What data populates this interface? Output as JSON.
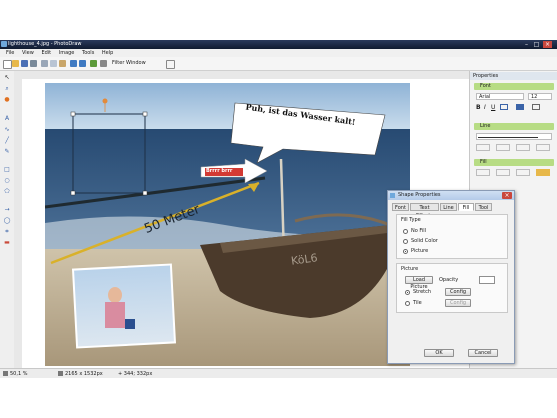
{
  "app": {
    "title": "lighthouse_4.jpg - PhotoDraw"
  },
  "menu": [
    "File",
    "View",
    "Edit",
    "Image",
    "Tools",
    "Help"
  ],
  "toolbar": {
    "filter_window": "Filter Window"
  },
  "canvas": {
    "speech_bubble": "Puh, ist das Wasser kalt!",
    "arrow_label": "Brrrr brrr",
    "measure_label": "50 Meter",
    "boat_label": "KöL6"
  },
  "properties_panel": {
    "title": "Properties",
    "font_group": "Font",
    "font_name": "Arial",
    "font_size": "12",
    "line_group": "Line",
    "fill_group": "Fill"
  },
  "dialog": {
    "title": "Shape Properties",
    "tabs": [
      "Font",
      "Text Effects",
      "Line",
      "Fill",
      "Tool"
    ],
    "active_tab": "Fill",
    "fill_type_label": "Fill Type",
    "fill_options": [
      "No Fill",
      "Solid Color",
      "Picture"
    ],
    "selected_fill": "Picture",
    "picture_label": "Picture",
    "load_picture": "Load Picture",
    "opacity_label": "Opacity",
    "stretch_label": "Stretch",
    "tile_label": "Tile",
    "config_label": "Config",
    "ok": "OK",
    "cancel": "Cancel"
  },
  "status": {
    "zoom": "50,1 %",
    "image_size": "2165 x 1532px",
    "coords": "+ 344; 332px"
  },
  "colors": {
    "accent_green": "#b7dc84",
    "titlebar": "#1b2740",
    "sea": "#2b4f78",
    "arrow_yellow": "#d9b12a"
  }
}
